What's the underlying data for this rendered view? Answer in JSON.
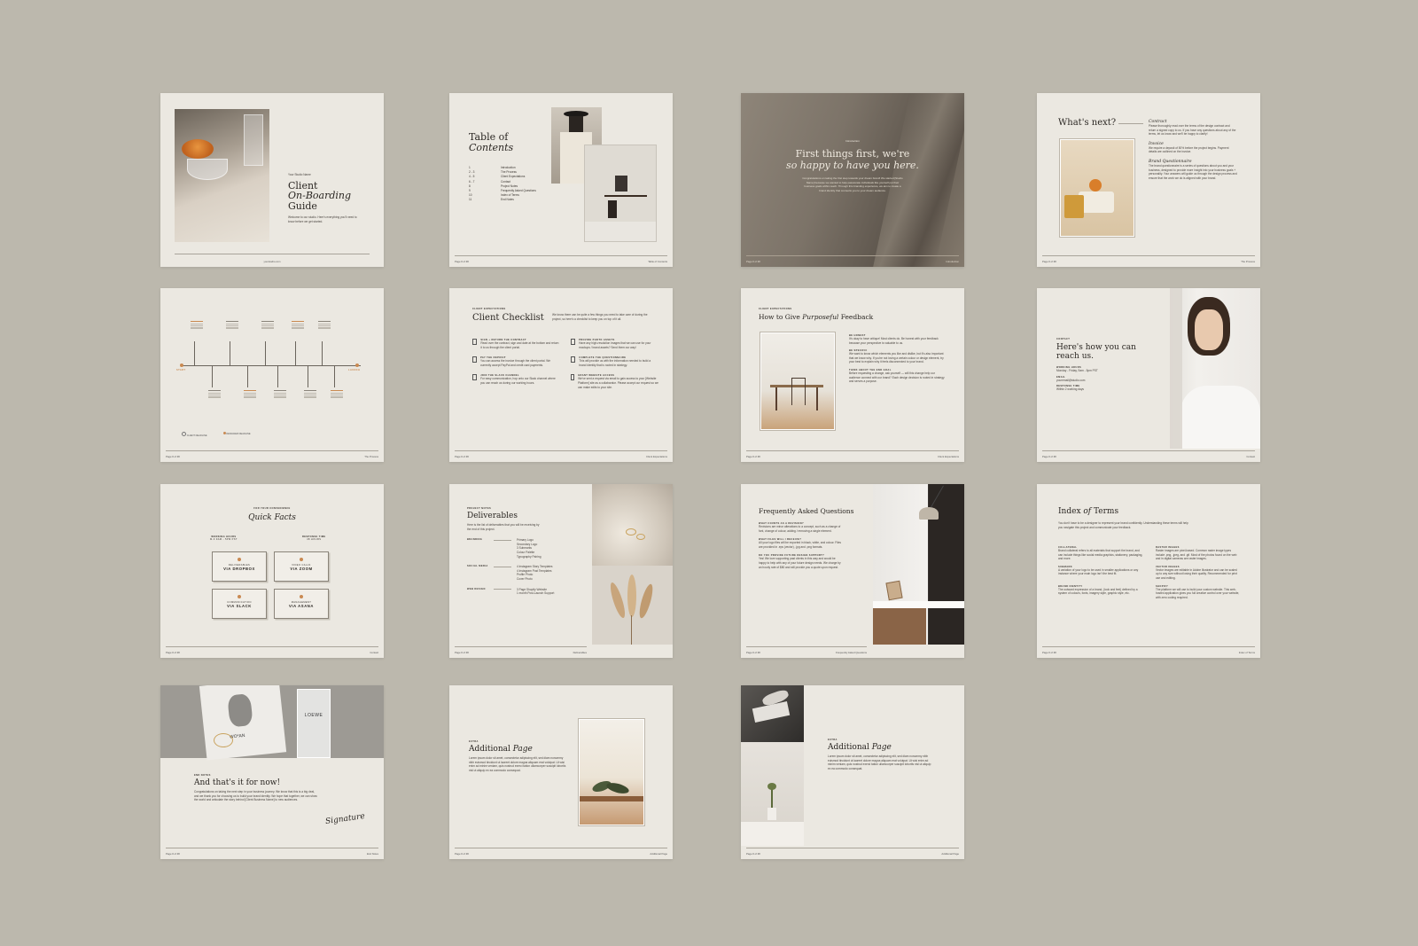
{
  "cover": {
    "eyebrow": "Your Studio Name",
    "title_l1": "Client",
    "title_l2": "On-Boarding",
    "title_l3": "Guide",
    "intro": "Welcome to our studio. Here's everything you'll need to know before we get started.",
    "footer": "yourstudio.com"
  },
  "toc": {
    "title_l1": "Table of",
    "title_l2": "Contents",
    "items": [
      {
        "num": "1",
        "label": "Introduction"
      },
      {
        "num": "2 - 3",
        "label": "The Process"
      },
      {
        "num": "4 - 5",
        "label": "Client Expectations"
      },
      {
        "num": "6 - 7",
        "label": "Contact"
      },
      {
        "num": "8",
        "label": "Project Notes"
      },
      {
        "num": "9",
        "label": "Frequently Asked Questions"
      },
      {
        "num": "10",
        "label": "Index of Terms"
      },
      {
        "num": "11",
        "label": "End Notes"
      }
    ],
    "footer_left": "Page # of ##",
    "footer_right": "Table of Contents"
  },
  "intro": {
    "eyebrow": "Introduction",
    "title_l1": "First things first, we're",
    "title_l2": "so happy to have you here.",
    "body": "Congratulations on taking the first step towards your dream brand! We started [Studio Name] because we wanted to help passionate individuals like yourself put their business goals within reach. Through this branding experience, we aim to create a brand identity that connects you to your dream audience.",
    "footer_left": "Page # of ##",
    "footer_right": "Introduction"
  },
  "next": {
    "title": "What's next?",
    "s1_title": "Contract",
    "s1_body": "Please thoroughly read over the terms of the design contract and return a signed copy to us. If you have any questions about any of the terms, let us know and we'll be happy to clarify!",
    "s2_title": "Invoice",
    "s2_body": "We require a deposit of 50% before the project begins. Payment details are outlined on the invoice.",
    "s3_title": "Brand Questionnaire",
    "s3_body": "The brand questionnaire is a series of questions about you and your business, designed to provide more insight into your business goals + personality. Your answers will guide us through the design process and ensure that the work we do is aligned with your brand.",
    "footer_left": "Page # of ##",
    "footer_right": "The Process"
  },
  "process": {
    "start": "START",
    "launch": "LAUNCH",
    "legend_client": "CLIENT DEADLINE",
    "legend_designer": "DESIGNER DEADLINE",
    "footer_left": "Page # of ##",
    "footer_right": "The Process"
  },
  "checklist": {
    "eyebrow": "CLIENT EXPECTATIONS",
    "title": "Client Checklist",
    "intro": "We know there can be quite a few things you need to take care of during the project, so here's a checklist to keep you on top of it all.",
    "items": [
      {
        "title": "SIGN + RETURN THE CONTRACT",
        "body": "Read over the contract, sign and date at the bottom and return it to us through the client portal."
      },
      {
        "title": "PROVIDE PHOTO ASSETS",
        "body": "Have any high-resolution images that we can use for your mockups / brand assets? Send them our way!"
      },
      {
        "title": "PAY THE DEPOSIT",
        "body": "You can access the invoice through the client portal. We currently accept PayPal and credit card payments."
      },
      {
        "title": "COMPLETE THE QUESTIONNAIRE",
        "body": "This will provide us with the information needed to build a brand identity that is rooted in strategy."
      },
      {
        "title": "JOIN THE SLACK CHANNEL",
        "body": "For easy communication, hop onto our Slack channel where you can reach us during our working hours."
      },
      {
        "title": "GRANT WEBSITE ACCESS",
        "body": "We've sent a request via email to gain access to your [Website Platform] site as a collaborator. Please accept our request so we can make edits to your site."
      }
    ],
    "footer_left": "Page # of ##",
    "footer_right": "Client Expectations"
  },
  "feedback": {
    "eyebrow": "CLIENT EXPECTATIONS",
    "title_a": "How to Give ",
    "title_b": "Purposeful",
    "title_c": " Feedback",
    "s1": "BE HONEST",
    "s1_body": "It's okay to have critique! Most clients do. Be honest with your feedback because your perspective is valuable to us.",
    "s2": "BE SPECIFIC",
    "s2_body": "We want to know which elements you like and dislike, but it's also important that we know why. If you're not loving a certain colour or design element, try your best to explain why it feels disconnected to your brand.",
    "s3": "THINK ABOUT THE END GOAL",
    "s3_body": "Before requesting a change, ask yourself — will this change help our audience connect with our brand? Each design decision is rooted in strategy and serves a purpose.",
    "footer_left": "Page # of ##",
    "footer_right": "Client Expectations"
  },
  "contact": {
    "eyebrow": "CONTACT",
    "title_l1": "Here's how you can",
    "title_l2": "reach us.",
    "hours_label": "WORKING HOURS",
    "hours": "Monday - Friday, 9am - 5pm PST",
    "email_label": "EMAIL",
    "email": "youremail@studio.com",
    "response_label": "RESPONSE TIME",
    "response": "Within 2 working days",
    "footer_left": "Page # of ##",
    "footer_right": "Contact"
  },
  "facts": {
    "eyebrow": "FOR YOUR CONVENIENCE",
    "title": "Quick Facts",
    "left_label": "WORKING HOURS",
    "left_val": "M-F 9AM - 5PM PST",
    "right_label": "RESPONSE TIME",
    "right_val": "48 HOURS",
    "cards": [
      {
        "small": "DELIVERABLES",
        "big": "VIA DROPBOX"
      },
      {
        "small": "VIDEO CALLS",
        "big": "VIA ZOOM"
      },
      {
        "small": "COMMUNICATION",
        "big": "VIA SLACK"
      },
      {
        "small": "MANAGEMENT",
        "big": "VIA ASANA"
      }
    ],
    "footer_left": "Page # of ##",
    "footer_right": "Contact"
  },
  "deliverables": {
    "eyebrow": "PROJECT NOTES",
    "title": "Deliverables",
    "intro": "Here is the list of deliverables that you will be receiving by the end of this project.",
    "rows": [
      {
        "label": "BRANDING",
        "items": "Primary Logo\nSecondary Logo\n3 Submarks\nColour Palette\nTypography Pairing"
      },
      {
        "label": "SOCIAL MEDIA",
        "items": "4 Instagram Story Templates\n4 Instagram Post Templates\nProfile Photo\nCover Photo"
      },
      {
        "label": "WEB DESIGN",
        "items": "3 Page Shopify Website\n1 month Post-Launch Support"
      }
    ],
    "footer_left": "Page # of ##",
    "footer_right": "Deliverables"
  },
  "faq": {
    "title": "Frequently Asked Questions",
    "q1": "WHAT COUNTS AS A REVISION?",
    "a1": "Revisions are minor alterations to a concept, such as a change of font, change of colour, adding / removing a single element.",
    "q2": "WHAT FILES WILL I RECEIVE?",
    "a2": "All your logo files will be exported in black, white, and colour. Files are provided in .eps (vector), .jpg and .png formats.",
    "q3": "DO YOU PROVIDE FUTURE DESIGN SUPPORT?",
    "a3": "Yes! We love supporting past clients in this way and would be happy to help with any of your future design needs. We charge by an hourly rate of $80 and will provide you a quote upon request.",
    "footer_left": "Page # of ##",
    "footer_right": "Frequently Asked Questions"
  },
  "index": {
    "title_a": "Index ",
    "title_b": "of",
    "title_c": " Terms",
    "intro": "You don't have to be a designer to represent your brand confidently. Understanding these terms will help you navigate this project and communicate your feedback.",
    "terms": [
      {
        "t": "COLLATERAL",
        "d": "Brand collateral refers to all materials that support the brand, and can include things like social media graphics, stationery, packaging, and more."
      },
      {
        "t": "RASTER IMAGES",
        "d": "Raster images are pixel-based. Common raster image types include .png, .jpeg, and .gif. Most of the photos found on the web and in digital cameras are raster images."
      },
      {
        "t": "SUBMARK",
        "d": "A variation of your logo to be used in smaller applications or any instance where your main logo isn't the best fit."
      },
      {
        "t": "VECTOR IMAGES",
        "d": "Vector images are editable in Adobe Illustrator and can be scaled up to any size without losing their quality. Recommended for print use and editing."
      },
      {
        "t": "BRAND IDENTITY",
        "d": "The outward expression of a brand, (look and feel) defined by a system of colours, fonts, imagery style, graphic style, etc."
      },
      {
        "t": "SHOPIFY",
        "d": "The platform we will use to build your custom website. This web-hosted application gives you full creative control over your website, with zero coding required."
      }
    ],
    "footer_left": "Page # of ##",
    "footer_right": "Index of Terms"
  },
  "endnotes": {
    "eyebrow": "END NOTES",
    "title": "And that's it for now!",
    "body": "Congratulations on taking the next step in your business journey. We know that this is a big deal, and we thank you for choosing us to build your brand identity. We hope that together, we can show the world and articulate the story behind [Client Business Name] to new audiences.",
    "signature": "Signature",
    "bottle_brand": "LOEWE",
    "card_text": "WO*AN",
    "footer_left": "Page # of ##",
    "footer_right": "End Notes"
  },
  "addl1": {
    "eyebrow": "EXTRA",
    "title_a": "Additional ",
    "title_b": "Page",
    "body": "Lorem ipsum dolor sit amet, consectetur adipiscing elit, sed diam nonummy nibh euismod tincidunt ut laoreet dolore magna aliquam erat volutpat. Ut wisi enim ad minim veniam, quis nostrud exerci tation ullamcorper suscipit lobortis nisl ut aliquip ex ea commodo consequat.",
    "footer_left": "Page # of ##",
    "footer_right": "Additional Page"
  },
  "addl2": {
    "eyebrow": "EXTRA",
    "title_a": "Additional ",
    "title_b": "Page",
    "body": "Lorem ipsum dolor sit amet, consectetur adipiscing elit, sed diam nonummy nibh euismod tincidunt ut laoreet dolore magna aliquam erat volutpat. Ut wisi enim ad minim veniam, quis nostrud exerci tation ullamcorper suscipit lobortis nisl ut aliquip ex ea commodo consequat.",
    "footer_left": "Page # of ##",
    "footer_right": "Additional Page"
  },
  "colors": {
    "background": "#bcb8ad",
    "paper": "#ebe8e1",
    "accent": "#c98a52",
    "ink": "#2a2622"
  }
}
